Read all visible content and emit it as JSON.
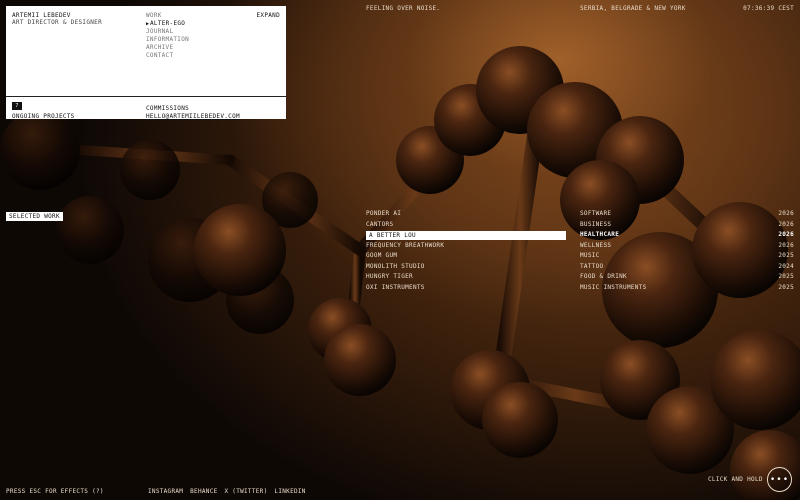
{
  "profile": {
    "name": "ARTEMII LEBEDEV",
    "role": "ART DIRECTOR & DESIGNER"
  },
  "nav": {
    "items": [
      {
        "label": "WORK",
        "active": false
      },
      {
        "label": "ALTER-EGO",
        "active": true
      },
      {
        "label": "JOURNAL",
        "active": false
      },
      {
        "label": "INFORMATION",
        "active": false
      },
      {
        "label": "ARCHIVE",
        "active": false
      },
      {
        "label": "CONTACT",
        "active": false
      }
    ],
    "expand_label": "EXPAND"
  },
  "ongoing": {
    "badge": "7",
    "label": "ONGOING PROJECTS"
  },
  "commissions": {
    "label": "COMMISSIONS",
    "email": "HELLO@ARTEMIILEBEDEV.COM"
  },
  "header": {
    "tagline": "FEELING OVER NOISE.",
    "location": "SERBIA, BELGRADE & NEW YORK",
    "time": "07:36:39 CEST"
  },
  "selected_work_label": "SELECTED WORK",
  "projects": [
    {
      "name": "PONDER AI",
      "category": "SOFTWARE",
      "year": "2026",
      "active": false
    },
    {
      "name": "CANTORS",
      "category": "BUSINESS",
      "year": "2026",
      "active": false
    },
    {
      "name": "A BETTER LOU",
      "category": "HEALTHCARE",
      "year": "2026",
      "active": true
    },
    {
      "name": "FREQUENCY BREATHWORK",
      "category": "WELLNESS",
      "year": "2026",
      "active": false
    },
    {
      "name": "GOOM GUM",
      "category": "MUSIC",
      "year": "2025",
      "active": false
    },
    {
      "name": "MONOLITH STUDIO",
      "category": "TATTOO",
      "year": "2024",
      "active": false
    },
    {
      "name": "HUNGRY TIGER",
      "category": "FOOD & DRINK",
      "year": "2025",
      "active": false
    },
    {
      "name": "OXI INSTRUMENTS",
      "category": "MUSIC INSTRUMENTS",
      "year": "2025",
      "active": false
    }
  ],
  "footer": {
    "esc_hint": "PRESS ESC FOR EFFECTS (?)",
    "social": [
      "INSTAGRAM",
      "BEHANCE",
      "X (TWITTER)",
      "LINKEDIN"
    ],
    "hold_label": "CLICK AND HOLD",
    "more_icon": "more-dots-icon",
    "more_glyph": "•••"
  },
  "colors": {
    "background": "#0b0704",
    "glow": "#a0602a",
    "text": "#e9dcc9",
    "panel": "#ffffff"
  }
}
